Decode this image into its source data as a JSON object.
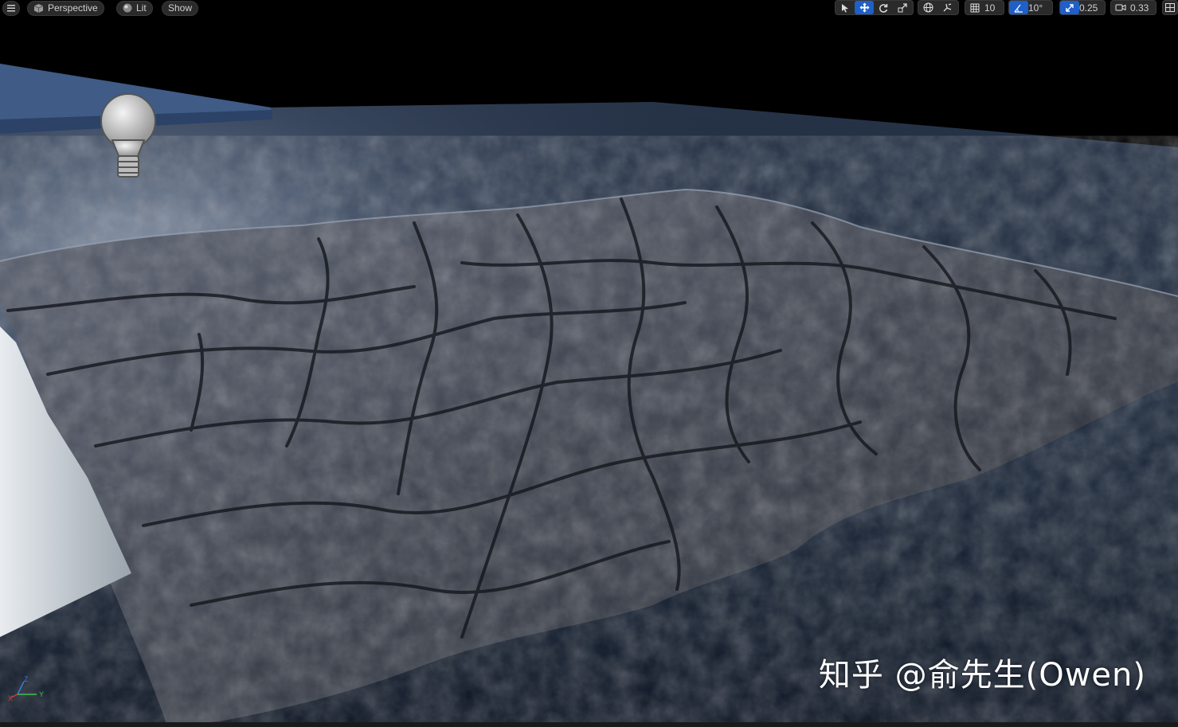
{
  "toolbar": {
    "menu_icon": "hamburger-icon",
    "view_mode": {
      "label": "Perspective",
      "icon": "cube-icon"
    },
    "lighting_mode": {
      "label": "Lit",
      "icon": "sphere-icon"
    },
    "show_label": "Show",
    "grid_snap_value": "10",
    "rotation_snap_value": "10°",
    "scale_snap_value": "0.25",
    "camera_speed_value": "0.33",
    "active_color": "#1e5fc8"
  },
  "axis_gizmo": {
    "z": "Z",
    "y": "Y",
    "x": "X"
  },
  "watermark": "知乎 @俞先生(Owen)"
}
